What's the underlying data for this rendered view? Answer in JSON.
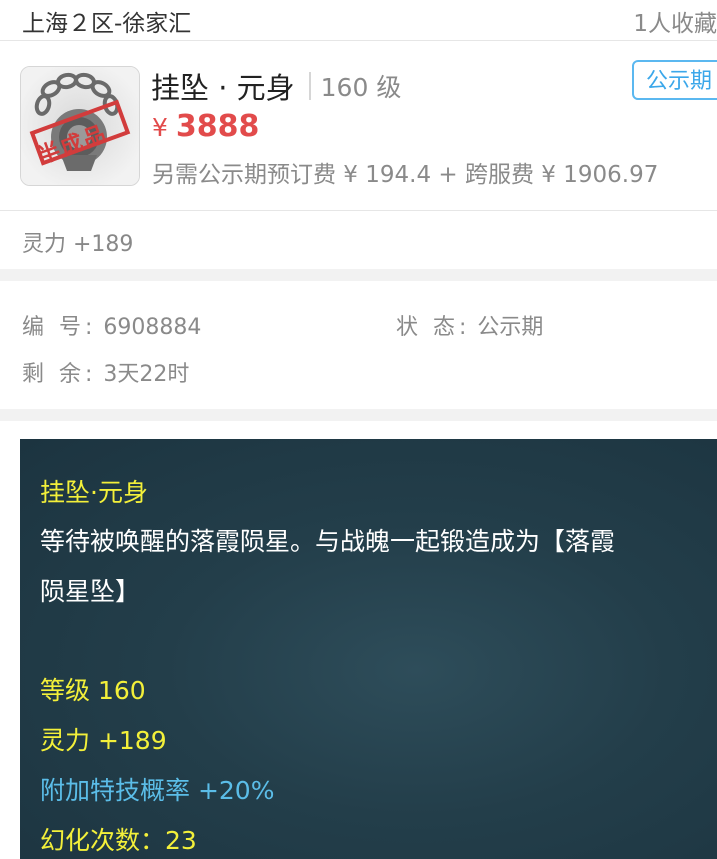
{
  "header": {
    "server": "上海２区-徐家汇",
    "favorites": "1人收藏"
  },
  "item": {
    "name": "挂坠 · 元身",
    "level": "160 级",
    "price_symbol": "¥",
    "price": "3888",
    "fee_text": "另需公示期预订费 ¥ 194.4 + 跨服费 ¥ 1906.97",
    "status_tag": "公示期",
    "stamp_text": "半成品",
    "attribute": "灵力 +189"
  },
  "info": {
    "id_label": "编 号:",
    "id_value": "6908884",
    "status_label": "状 态:",
    "status_value": "公示期",
    "remaining_label": "剩 余:",
    "remaining_value": "3天22时"
  },
  "description": {
    "title": "挂坠·元身",
    "text_line1": "等待被唤醒的落霞陨星。与战魄一起锻造成为【落霞",
    "text_line2": "陨星坠】",
    "level": "等级 160",
    "spirit": "灵力 +189",
    "skill_rate": "附加特技概率 +20%",
    "transform_count": "幻化次数：23"
  },
  "colors": {
    "price_red": "#e24b4b",
    "status_blue": "#3ba7ea",
    "desc_yellow": "#f3f03a",
    "desc_blue": "#5bbde8",
    "desc_bg": "#233e4a"
  },
  "icons": {
    "thumbnail": "pendant-chain-icon"
  }
}
